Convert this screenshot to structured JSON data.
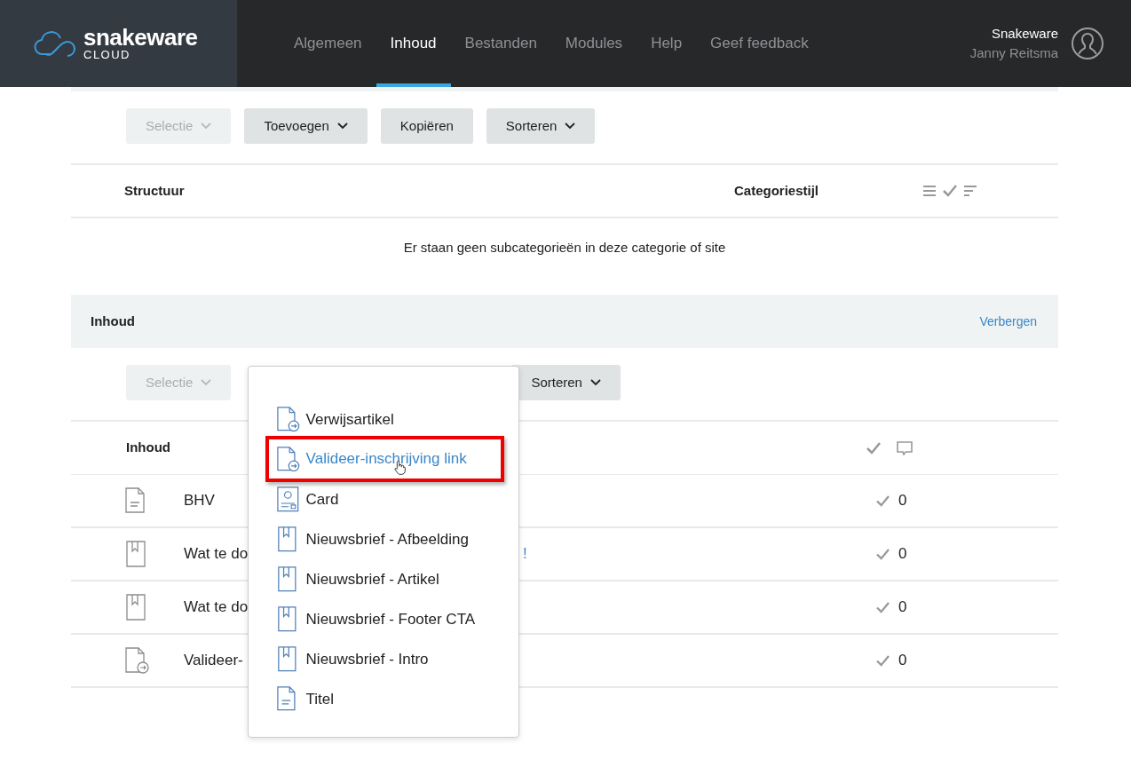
{
  "brand": {
    "name": "snakeware",
    "sub": "CLOUD"
  },
  "nav": [
    {
      "label": "Algemeen",
      "selected": false
    },
    {
      "label": "Inhoud",
      "selected": true
    },
    {
      "label": "Bestanden",
      "selected": false
    },
    {
      "label": "Modules",
      "selected": false
    },
    {
      "label": "Help",
      "selected": false
    },
    {
      "label": "Geef feedback",
      "selected": false
    }
  ],
  "user": {
    "org": "Snakeware",
    "name": "Janny Reitsma"
  },
  "toolbar_1": [
    {
      "label": "Selectie",
      "disabled": true,
      "caret": true
    },
    {
      "label": "Toevoegen",
      "disabled": false,
      "caret": true
    },
    {
      "label": "Kopiëren",
      "disabled": false,
      "caret": false
    },
    {
      "label": "Sorteren",
      "disabled": false,
      "caret": true
    }
  ],
  "structure_table": {
    "columns": [
      "Structuur",
      "Categoriestijl"
    ],
    "empty_message": "Er staan geen subcategorieën in deze categorie of site"
  },
  "content_section": {
    "title": "Inhoud",
    "action": "Verbergen"
  },
  "toolbar_2": [
    {
      "label": "Selectie",
      "disabled": true,
      "caret": true
    },
    {
      "label": "Sorteren",
      "disabled": false,
      "caret": true
    }
  ],
  "content_table": {
    "column": "Inhoud",
    "rows": [
      {
        "kind": "text",
        "title": "BHV",
        "tail": "",
        "count": "0"
      },
      {
        "kind": "newsletter",
        "title": "Wat te do",
        "tail": "!",
        "count": "0"
      },
      {
        "kind": "newsletter",
        "title": "Wat te do",
        "tail": "",
        "count": "0"
      },
      {
        "kind": "redirect",
        "title": "Valideer-",
        "tail": "",
        "count": "0"
      }
    ]
  },
  "add_menu": [
    {
      "kind": "redirect",
      "label": "Verwijsartikel",
      "selected": false
    },
    {
      "kind": "redirect",
      "label": "Valideer-inschrijving link",
      "selected": true
    },
    {
      "kind": "card",
      "label": "Card",
      "selected": false
    },
    {
      "kind": "newsletter",
      "label": "Nieuwsbrief - Afbeelding",
      "selected": false
    },
    {
      "kind": "newsletter",
      "label": "Nieuwsbrief - Artikel",
      "selected": false
    },
    {
      "kind": "newsletter",
      "label": "Nieuwsbrief - Footer CTA",
      "selected": false
    },
    {
      "kind": "newsletter",
      "label": "Nieuwsbrief - Intro",
      "selected": false
    },
    {
      "kind": "text",
      "label": "Titel",
      "selected": false
    }
  ]
}
